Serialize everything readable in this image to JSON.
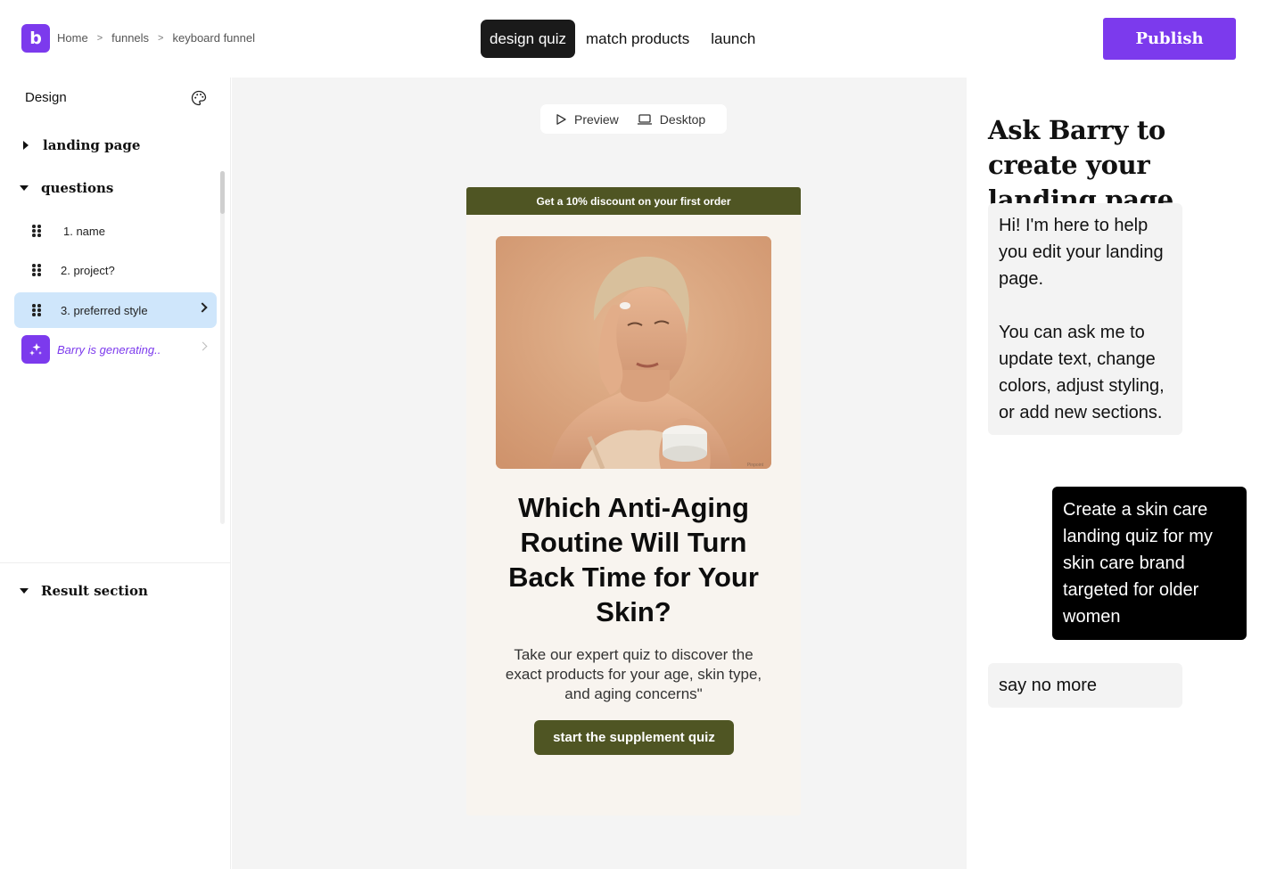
{
  "header": {
    "logo": "b",
    "breadcrumb": [
      "Home",
      "funnels",
      "keyboard funnel"
    ],
    "breadcrumb_sep": ">",
    "tabs": [
      "design quiz",
      "match products",
      "launch"
    ],
    "publish_label": "Publish",
    "accent": "#7c3aed"
  },
  "sidebar": {
    "title": "Design",
    "sections": {
      "landing": "landing page",
      "questions": "questions",
      "result": "Result section"
    },
    "questions": [
      "1. name",
      "2. project?",
      "3. preferred style"
    ],
    "generating": "Barry is generating.."
  },
  "canvas": {
    "preview_label": "Preview",
    "device_label": "Desktop",
    "quiz": {
      "banner": "Get a 10% discount on your first order",
      "title": "Which Anti-Aging Routine Will Turn Back Time for Your Skin?",
      "subtitle": "Take our expert quiz to discover the exact products for your age, skin type, and aging concerns\"",
      "cta": "start the supplement quiz",
      "brand_color": "#4f5523",
      "image_watermark": "Pinpoint"
    }
  },
  "chat": {
    "title": "Ask Barry to create your landing page",
    "messages": [
      {
        "role": "bot",
        "text_1": "Hi! I'm here to help you edit your landing page.",
        "text_2": "You can ask me to update text, change colors, adjust styling, or add new sections."
      },
      {
        "role": "user",
        "text": "Create a skin care landing quiz for my skin care brand targeted for older women"
      },
      {
        "role": "bot",
        "text": "say no more"
      }
    ]
  }
}
